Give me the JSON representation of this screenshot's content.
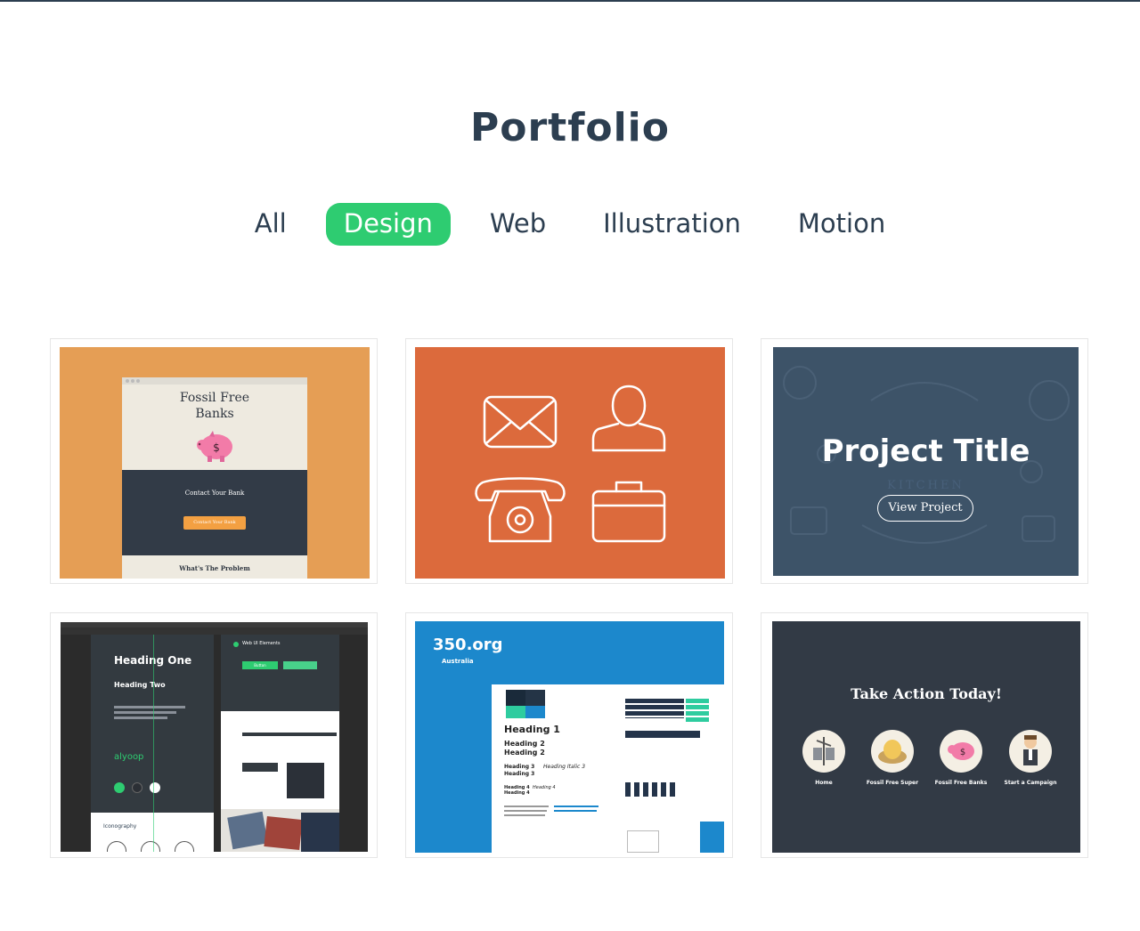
{
  "page": {
    "title": "Portfolio"
  },
  "filters": [
    {
      "label": "All",
      "active": false
    },
    {
      "label": "Design",
      "active": true
    },
    {
      "label": "Web",
      "active": false
    },
    {
      "label": "Illustration",
      "active": false
    },
    {
      "label": "Motion",
      "active": false
    }
  ],
  "colors": {
    "accent": "#2ecc71",
    "text": "#2c3e50"
  },
  "cards": {
    "fossil": {
      "heading": "Fossil Free Banks",
      "section": "Contact Your Bank",
      "button": "Contact Your Bank",
      "footer": "What's The Problem",
      "bg": "#e59e55"
    },
    "icons": {
      "bg": "#dc6a3c",
      "icons": [
        "envelope-icon",
        "user-icon",
        "phone-icon",
        "briefcase-icon"
      ]
    },
    "project": {
      "title": "Project Title",
      "button": "View Project",
      "watermark": "KITCHEN",
      "bg": "#3d5368"
    },
    "styleguide": {
      "heading_one": "Heading One",
      "heading_two": "Heading Two",
      "web_ui": "Web UI Elements",
      "logo": "alyoop",
      "iconography": "Iconography",
      "button": "Button"
    },
    "org350": {
      "logo": "350.org",
      "country": "Australia",
      "h1": "Heading 1",
      "h2a": "Heading 2",
      "h2b": "Heading 2",
      "h3a": "Heading 3",
      "h3b": "Heading 3",
      "h3i": "Heading Italic 3",
      "h4a": "Heading 4",
      "h4b": "Heading 4",
      "h4i": "Heading 4",
      "bg": "#1c88cc"
    },
    "action": {
      "title": "Take Action Today!",
      "items": [
        "Home",
        "Fossil Free Super",
        "Fossil Free Banks",
        "Start a Campaign"
      ],
      "bg": "#323a45"
    }
  }
}
